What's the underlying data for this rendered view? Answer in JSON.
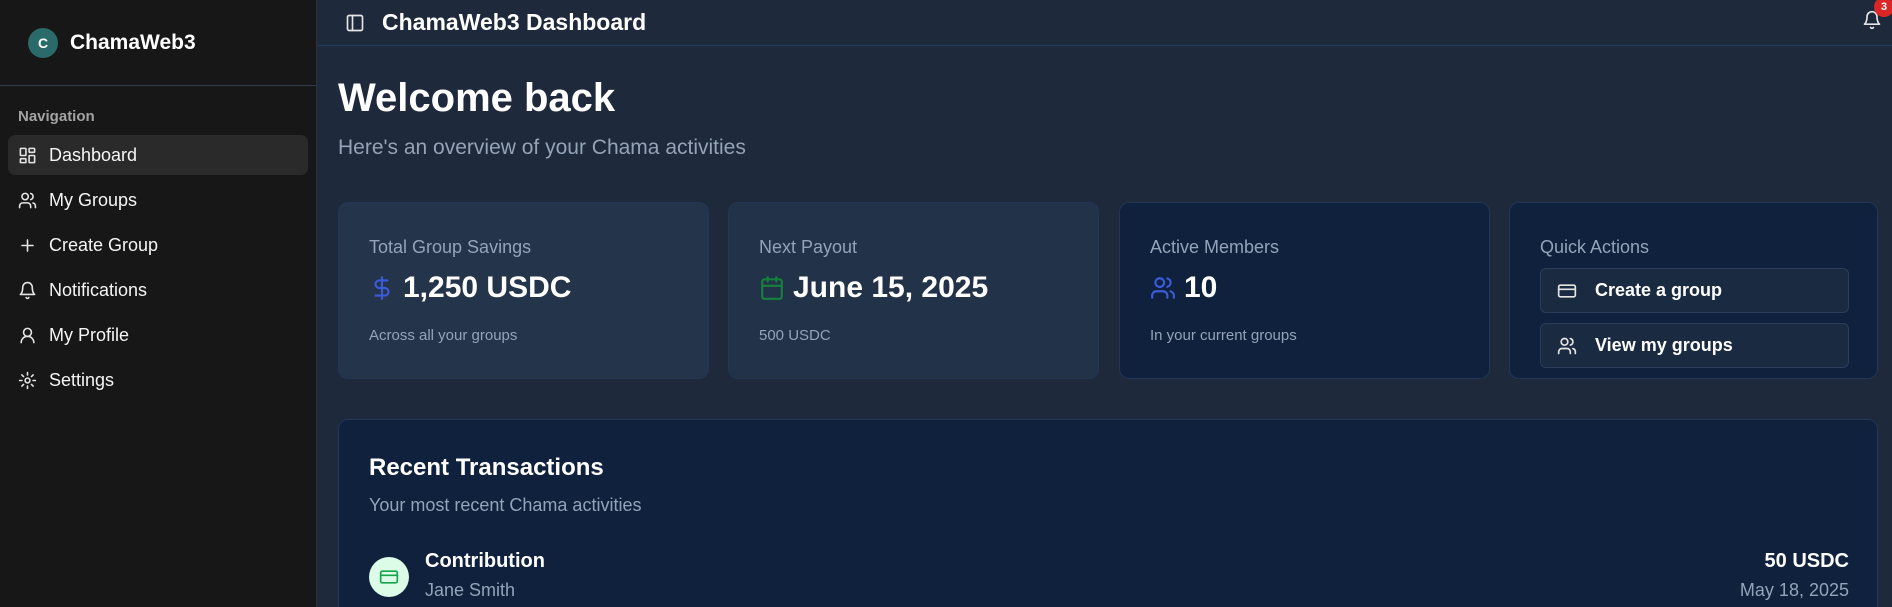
{
  "brand": {
    "initial": "C",
    "name": "ChamaWeb3"
  },
  "sidebar": {
    "heading": "Navigation",
    "items": [
      {
        "label": "Dashboard",
        "icon": "dashboard-icon",
        "active": true
      },
      {
        "label": "My Groups",
        "icon": "users-icon"
      },
      {
        "label": "Create Group",
        "icon": "plus-icon"
      },
      {
        "label": "Notifications",
        "icon": "bell-icon"
      },
      {
        "label": "My Profile",
        "icon": "user-icon"
      },
      {
        "label": "Settings",
        "icon": "gear-icon"
      }
    ]
  },
  "header": {
    "title": "ChamaWeb3 Dashboard",
    "notification_count": "3"
  },
  "main": {
    "welcome": "Welcome back",
    "subtitle": "Here's an overview of your Chama activities",
    "cards": {
      "savings": {
        "label": "Total Group Savings",
        "value": "1,250 USDC",
        "note": "Across all your groups",
        "icon": "dollar-icon",
        "icon_color": "#3b5bdb"
      },
      "payout": {
        "label": "Next Payout",
        "value": "June 15, 2025",
        "note": "500 USDC",
        "icon": "calendar-icon",
        "icon_color": "#15803d"
      },
      "members": {
        "label": "Active Members",
        "value": "10",
        "note": "In your current groups",
        "icon": "users-icon",
        "icon_color": "#3b5bdb"
      },
      "quick": {
        "label": "Quick Actions",
        "create": "Create a group",
        "view": "View my groups"
      }
    },
    "transactions": {
      "title": "Recent Transactions",
      "subtitle": "Your most recent Chama activities",
      "rows": [
        {
          "type": "Contribution",
          "name": "Jane Smith",
          "amount": "50 USDC",
          "date": "May 18, 2025",
          "icon": "credit-card-icon"
        }
      ]
    }
  },
  "colors": {
    "sidebar_bg": "#171717",
    "main_bg": "#1e293b",
    "card_dark": "#0f213d",
    "muted_text": "#94a3b8",
    "badge": "#dc2626"
  }
}
